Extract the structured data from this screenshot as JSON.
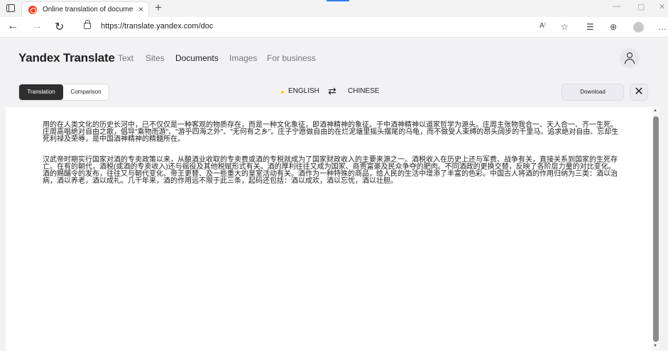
{
  "browser": {
    "tab_title": "Online translation of documents",
    "tab_close": "×",
    "new_tab": "+",
    "url": "https://translate.yandex.com/doc",
    "minimize": "—",
    "restore": "▢",
    "close": "✕"
  },
  "app": {
    "brand": "Yandex Translate",
    "nav": [
      "Text",
      "Sites",
      "Documents",
      "Images",
      "For business"
    ],
    "active_nav": "Documents"
  },
  "toolbar": {
    "translation_tab": "Translation",
    "comparison_tab": "Comparison",
    "source_lang": "ENGLISH",
    "target_lang": "CHINESE",
    "swap_icon": "⇄",
    "download": "Download",
    "close": "✕"
  },
  "document": {
    "paragraphs": [
      "用的在人类文化的历史长河中，已不仅仅是一种客观的物质存在，而是一种文化象征，即酒神精神的象征。于中酒神精神以道家哲学为源头。庄周主张物我合一、天人合一、齐一生死。庄周高唱绝对自由之歌，倡导\"乘物而游\"、\"游乎四海之外\"、\"无何有之乡\"。庄子宁愿做自由的在烂泥塘里摇头摆尾的乌龟，而不做受人束缚的昂头阔步的千里马。追求绝对自由、忘却生死利禄及荣辱，是中国酒神精神的精髓所在。",
      "汉武帝时期实行国家对酒的专卖政策以来，从酿酒业收取的专卖费或酒的专税就成为了国家财政收入的主要来源之一。酒税收入在历史上还与军费、战争有关，直接关系到国家的生死存亡。在有的朝代，酒税(或酒的专卖收入)还与徭役及其他税赋形式有关。酒的厚利往往又成为国家、商贾富豪及民众争夺的肥肉。不同酒政的更换交替，反映了各阶层力量的对比变化。酒的赐酺令的发布，往往又与朝代变化、帝王更替、及一些重大的皇室活动有关。酒作为一种特殊的商品，给人民的生活中增添了丰富的色彩。中国古人将酒的作用归纳为三类：酒以治病，酒以养老，酒以成礼。几千年来，酒的作用远不限于此三条，起码还包括：酒以成欢，酒以忘忧，酒以壮胆。"
    ]
  }
}
